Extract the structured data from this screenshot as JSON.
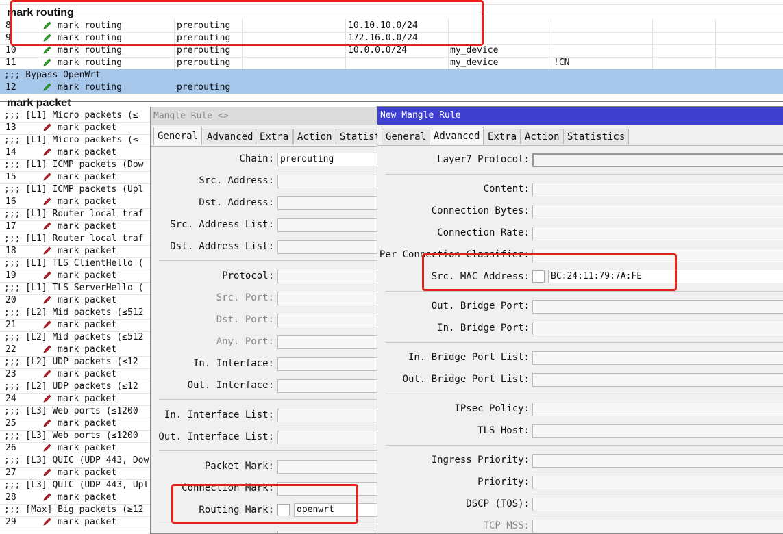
{
  "sections": {
    "routing_title": "mark routing",
    "packet_title": "mark packet"
  },
  "routing_rows": [
    {
      "num": "8",
      "action": "mark routing",
      "chain": "prerouting",
      "dst": "10.10.10.0/24",
      "list": "",
      "extra": ""
    },
    {
      "num": "9",
      "action": "mark routing",
      "chain": "prerouting",
      "dst": "172.16.0.0/24",
      "list": "",
      "extra": ""
    },
    {
      "num": "10",
      "action": "mark routing",
      "chain": "prerouting",
      "dst": "10.0.0.0/24",
      "list": "my_device",
      "extra": ""
    },
    {
      "num": "11",
      "action": "mark routing",
      "chain": "prerouting",
      "dst": "",
      "list": "my_device",
      "extra": "!CN"
    }
  ],
  "bypass_comment": ";;; Bypass OpenWrt",
  "selected_row": {
    "num": "12",
    "action": "mark routing",
    "chain": "prerouting"
  },
  "packet_rows": [
    {
      "comment": ";;; [L1] Micro packets (≤",
      "num": "13",
      "action": "mark packet"
    },
    {
      "comment": ";;; [L1] Micro packets (≤",
      "num": "14",
      "action": "mark packet"
    },
    {
      "comment": ";;; [L1] ICMP packets (Dow",
      "num": "15",
      "action": "mark packet"
    },
    {
      "comment": ";;; [L1] ICMP packets (Upl",
      "num": "16",
      "action": "mark packet"
    },
    {
      "comment": ";;; [L1] Router local traf",
      "num": "17",
      "action": "mark packet"
    },
    {
      "comment": ";;; [L1] Router local traf",
      "num": "18",
      "action": "mark packet"
    },
    {
      "comment": ";;; [L1] TLS ClientHello (",
      "num": "19",
      "action": "mark packet"
    },
    {
      "comment": ";;; [L1] TLS ServerHello (",
      "num": "20",
      "action": "mark packet"
    },
    {
      "comment": ";;; [L2] Mid packets (≤512",
      "num": "21",
      "action": "mark packet"
    },
    {
      "comment": ";;; [L2] Mid packets (≤512",
      "num": "22",
      "action": "mark packet"
    },
    {
      "comment": ";;; [L2] UDP packets (≤12",
      "num": "23",
      "action": "mark packet"
    },
    {
      "comment": ";;; [L2] UDP packets (≤12",
      "num": "24",
      "action": "mark packet"
    },
    {
      "comment": ";;; [L3] Web ports (≤1200",
      "num": "25",
      "action": "mark packet"
    },
    {
      "comment": ";;; [L3] Web ports (≤1200",
      "num": "26",
      "action": "mark packet"
    },
    {
      "comment": ";;; [L3] QUIC (UDP 443, Dow",
      "num": "27",
      "action": "mark packet"
    },
    {
      "comment": ";;; [L3] QUIC (UDP 443, Upl",
      "num": "28",
      "action": "mark packet"
    },
    {
      "comment": ";;; [Max] Big packets (≥12",
      "num": "29",
      "action": "mark packet"
    }
  ],
  "dialog1": {
    "title": "Mangle Rule <>",
    "tabs": [
      "General",
      "Advanced",
      "Extra",
      "Action",
      "Statist"
    ],
    "fields": {
      "chain": "Chain:",
      "chain_value": "prerouting",
      "src_address": "Src. Address:",
      "dst_address": "Dst. Address:",
      "src_address_list": "Src. Address List:",
      "dst_address_list": "Dst. Address List:",
      "protocol": "Protocol:",
      "src_port": "Src. Port:",
      "dst_port": "Dst. Port:",
      "any_port": "Any. Port:",
      "in_interface": "In. Interface:",
      "out_interface": "Out. Interface:",
      "in_interface_list": "In. Interface List:",
      "out_interface_list": "Out. Interface List:",
      "packet_mark": "Packet Mark:",
      "connection_mark": "Connection Mark:",
      "routing_mark": "Routing Mark:",
      "routing_mark_value": "openwrt"
    }
  },
  "dialog2": {
    "title": "New Mangle Rule",
    "tabs": [
      "General",
      "Advanced",
      "Extra",
      "Action",
      "Statistics"
    ],
    "fields": {
      "layer7": "Layer7 Protocol:",
      "content": "Content:",
      "connection_bytes": "Connection Bytes:",
      "connection_rate": "Connection Rate:",
      "per_conn_classifier": "Per Connection Classifier:",
      "src_mac": "Src. MAC Address:",
      "src_mac_value": "BC:24:11:79:7A:FE",
      "out_bridge_port": "Out. Bridge Port:",
      "in_bridge_port": "In. Bridge Port:",
      "in_bridge_port_list": "In. Bridge Port List:",
      "out_bridge_port_list": "Out. Bridge Port List:",
      "ipsec_policy": "IPsec Policy:",
      "tls_host": "TLS Host:",
      "ingress_priority": "Ingress Priority:",
      "priority": "Priority:",
      "dscp": "DSCP (TOS):",
      "tcp_mss": "TCP MSS:"
    }
  },
  "colors": {
    "highlight": "#e2231a",
    "selection": "#a7c7ea",
    "dialog2_title": "#3f3fd0"
  },
  "icons": {
    "routing": "green-pencil-icon",
    "packet": "red-pencil-icon"
  }
}
